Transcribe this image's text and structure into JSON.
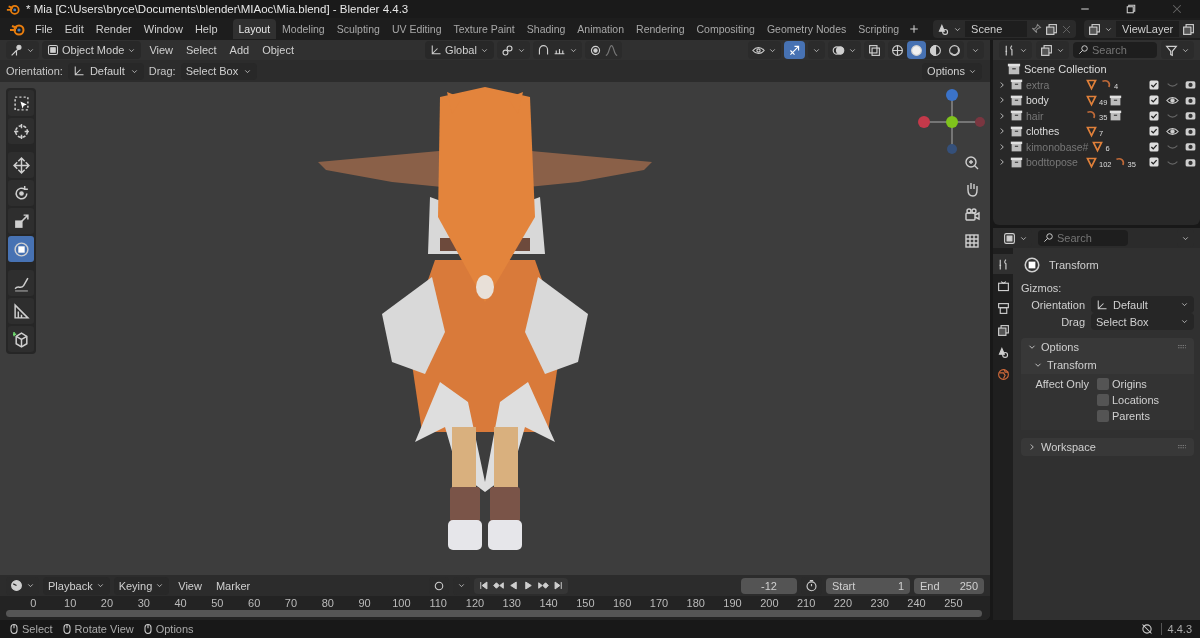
{
  "title_bar": {
    "title": "* Mia [C:\\Users\\bryce\\Documents\\blender\\MIAoc\\Mia.blend] - Blender 4.4.3"
  },
  "menu": [
    "File",
    "Edit",
    "Render",
    "Window",
    "Help"
  ],
  "workspaces": [
    {
      "label": "Layout",
      "selected": true
    },
    {
      "label": "Modeling",
      "selected": false
    },
    {
      "label": "Sculpting",
      "selected": false
    },
    {
      "label": "UV Editing",
      "selected": false
    },
    {
      "label": "Texture Paint",
      "selected": false
    },
    {
      "label": "Shading",
      "selected": false
    },
    {
      "label": "Animation",
      "selected": false
    },
    {
      "label": "Rendering",
      "selected": false
    },
    {
      "label": "Compositing",
      "selected": false
    },
    {
      "label": "Geometry Nodes",
      "selected": false
    },
    {
      "label": "Scripting",
      "selected": false
    }
  ],
  "scene": {
    "name": "Scene"
  },
  "view_layer": {
    "name": "ViewLayer"
  },
  "viewport": {
    "mode": "Object Mode",
    "menus": [
      "View",
      "Select",
      "Add",
      "Object"
    ],
    "orientation": "Global",
    "gizmos_on": true,
    "shading_modes": [
      {
        "selected": false
      },
      {
        "selected": true
      },
      {
        "selected": false
      },
      {
        "selected": false
      }
    ],
    "tool_settings": {
      "orientation_label": "Orientation:",
      "orientation": "Default",
      "drag_label": "Drag:",
      "drag": "Select Box",
      "options": "Options"
    },
    "tools": [
      {
        "selected": false
      },
      {
        "selected": false
      },
      {
        "selected": false
      },
      {
        "selected": false
      },
      {
        "selected": false
      },
      {
        "selected": true
      },
      {
        "selected": false
      },
      {
        "selected": false
      },
      {
        "selected": false
      }
    ]
  },
  "timeline": {
    "menus": [
      "Playback",
      "Keying",
      "View",
      "Marker"
    ],
    "current_frame": "-12",
    "start_label": "Start",
    "start": "1",
    "end_label": "End",
    "end": "250",
    "ticks": [
      "0",
      "10",
      "20",
      "30",
      "40",
      "50",
      "60",
      "70",
      "80",
      "90",
      "100",
      "110",
      "120",
      "130",
      "140",
      "150",
      "160",
      "170",
      "180",
      "190",
      "200",
      "210",
      "220",
      "230",
      "240",
      "250"
    ]
  },
  "outliner": {
    "search": {
      "placeholder": "Search"
    },
    "root": "Scene Collection",
    "collections": [
      {
        "name": "extra",
        "visible": false,
        "included": true,
        "badges": [
          {
            "kind": "mesh"
          },
          {
            "kind": "armature",
            "count": "4"
          }
        ]
      },
      {
        "name": "body",
        "visible": true,
        "included": true,
        "badges": [
          {
            "kind": "mesh",
            "count": "49"
          },
          {
            "kind": "collection"
          }
        ]
      },
      {
        "name": "hair",
        "visible": false,
        "included": true,
        "badges": [
          {
            "kind": "armature",
            "count": "35"
          },
          {
            "kind": "collection"
          }
        ]
      },
      {
        "name": "clothes",
        "visible": true,
        "included": true,
        "badges": [
          {
            "kind": "mesh",
            "count": "7"
          }
        ]
      },
      {
        "name": "kimonobase#",
        "visible": false,
        "included": true,
        "badges": [
          {
            "kind": "mesh",
            "count": "6"
          }
        ]
      },
      {
        "name": "bodttopose",
        "visible": false,
        "included": true,
        "badges": [
          {
            "kind": "mesh",
            "count": "102"
          },
          {
            "kind": "armature",
            "count": "35"
          }
        ]
      }
    ]
  },
  "properties": {
    "search": {
      "placeholder": "Search"
    },
    "tabs": [
      {
        "selected": true
      },
      {
        "selected": false
      },
      {
        "selected": false
      },
      {
        "selected": false
      },
      {
        "selected": false
      },
      {
        "selected": false
      }
    ],
    "title": "Transform",
    "gizmos_label": "Gizmos:",
    "fields": [
      {
        "label": "Orientation",
        "value": "Default"
      },
      {
        "label": "Drag",
        "value": "Select Box"
      }
    ],
    "panels": [
      {
        "title": "Options",
        "expanded": true,
        "subpanels": [
          {
            "title": "Transform",
            "expanded": true,
            "group_label": "Affect Only",
            "options": [
              {
                "label": "Origins",
                "checked": false
              },
              {
                "label": "Locations",
                "checked": false
              },
              {
                "label": "Parents",
                "checked": false
              }
            ]
          }
        ]
      },
      {
        "title": "Workspace",
        "expanded": false
      }
    ]
  },
  "status_bar": {
    "hints": [
      "Select",
      "Rotate View",
      "Options"
    ],
    "version": "4.4.3"
  }
}
